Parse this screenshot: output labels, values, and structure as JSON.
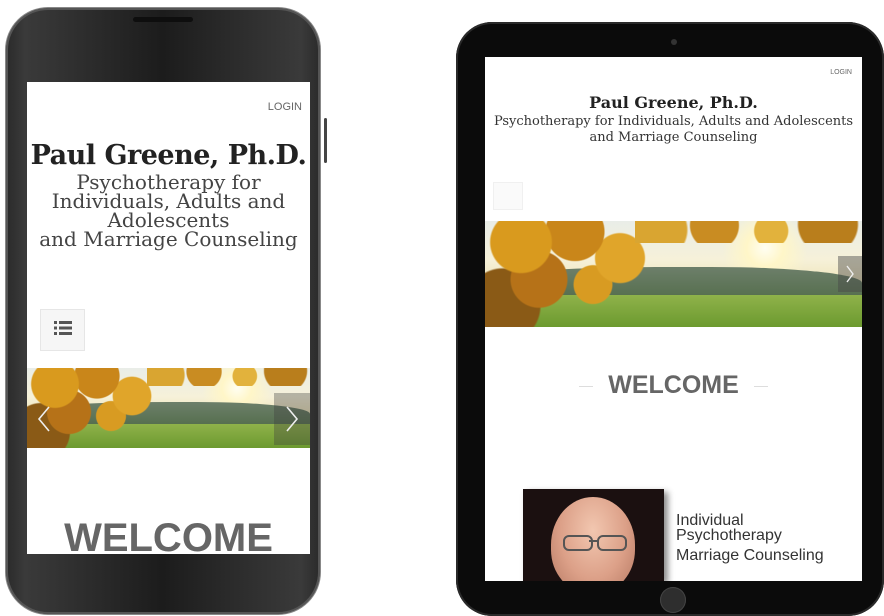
{
  "site": {
    "login": "LOGIN",
    "name": "Paul Greene, Ph.D.",
    "phone_tagline_line1": "Psychotherapy for Individuals, Adults and Adolescents",
    "phone_tagline_line2": "and Marriage Counseling",
    "tablet_tagline_line1": "Psychotherapy for Individuals, Adults and Adolescents",
    "tablet_tagline_line2": "and Marriage Counseling",
    "welcome": "WELCOME"
  },
  "services": [
    "Individual",
    "Psychotherapy",
    "Marriage Counseling"
  ],
  "icons": {
    "menu": "list-menu-icon",
    "prev": "chevron-left-icon",
    "next": "chevron-right-icon"
  },
  "colors": {
    "device_frame": "#1c1c1c",
    "title_text": "#222222",
    "welcome_text": "#666666"
  }
}
